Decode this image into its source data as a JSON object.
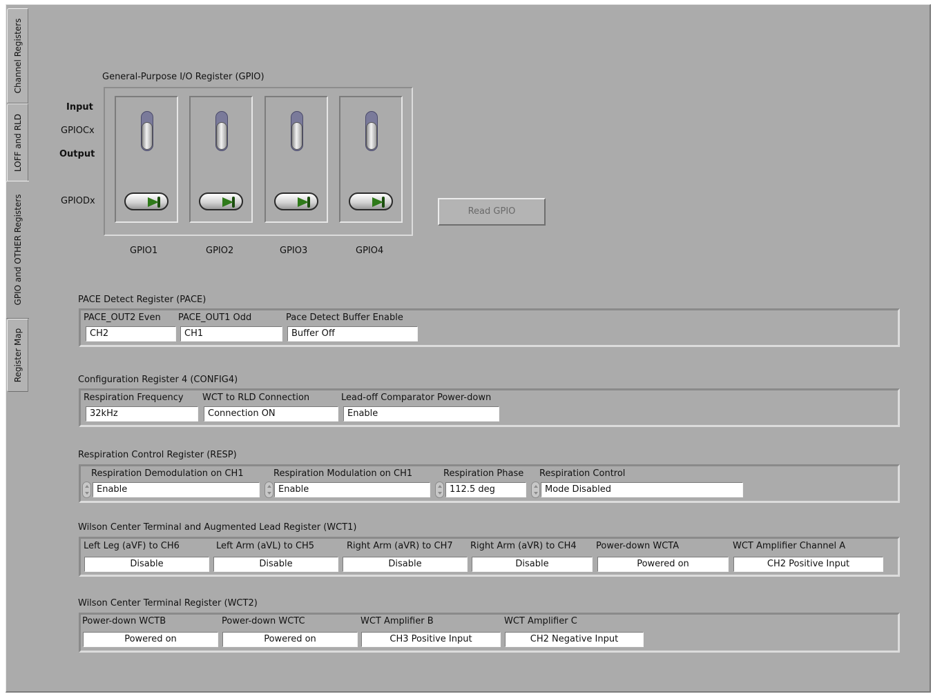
{
  "tabs": [
    {
      "label": "Channel Registers",
      "active": false
    },
    {
      "label": "LOFF and RLD",
      "active": false
    },
    {
      "label": "GPIO and OTHER Registers",
      "active": true
    },
    {
      "label": "Register Map",
      "active": false
    }
  ],
  "gpio": {
    "title": "General-Purpose I/O Register (GPIO)",
    "row_input": "Input",
    "row_gpiocx": "GPIOCx",
    "row_output": "Output",
    "row_gpiodx": "GPIODx",
    "columns": [
      "GPIO1",
      "GPIO2",
      "GPIO3",
      "GPIO4"
    ],
    "read_button": "Read GPIO"
  },
  "pace": {
    "title": "PACE Detect Register (PACE)",
    "fields": [
      {
        "label": "PACE_OUT2 Even",
        "value": "CH2"
      },
      {
        "label": "PACE_OUT1 Odd",
        "value": "CH1"
      },
      {
        "label": "Pace Detect Buffer Enable",
        "value": "Buffer Off"
      }
    ]
  },
  "config4": {
    "title": "Configuration Register 4 (CONFIG4)",
    "fields": [
      {
        "label": "Respiration Frequency",
        "value": "32kHz"
      },
      {
        "label": "WCT to RLD Connection",
        "value": "Connection ON"
      },
      {
        "label": "Lead-off Comparator Power-down",
        "value": "Enable"
      }
    ]
  },
  "resp": {
    "title": "Respiration Control Register (RESP)",
    "fields": [
      {
        "label": "Respiration Demodulation on CH1",
        "value": "Enable"
      },
      {
        "label": "Respiration Modulation on CH1",
        "value": "Enable"
      },
      {
        "label": "Respiration Phase",
        "value": "112.5 deg"
      },
      {
        "label": "Respiration Control",
        "value": "Mode Disabled"
      }
    ]
  },
  "wct1": {
    "title": "Wilson Center Terminal and Augmented Lead Register (WCT1)",
    "fields": [
      {
        "label": "Left Leg (aVF) to CH6",
        "value": "Disable"
      },
      {
        "label": "Left Arm (aVL) to CH5",
        "value": "Disable"
      },
      {
        "label": "Right Arm (aVR) to CH7",
        "value": "Disable"
      },
      {
        "label": "Right Arm (aVR) to CH4",
        "value": "Disable"
      },
      {
        "label": "Power-down WCTA",
        "value": "Powered on"
      },
      {
        "label": "WCT Amplifier Channel A",
        "value": "CH2 Positive Input"
      }
    ]
  },
  "wct2": {
    "title": "Wilson Center Terminal Register (WCT2)",
    "fields": [
      {
        "label": "Power-down WCTB",
        "value": "Powered on"
      },
      {
        "label": "Power-down WCTC",
        "value": "Powered on"
      },
      {
        "label": "WCT Amplifier B",
        "value": "CH3 Positive Input"
      },
      {
        "label": "WCT Amplifier C",
        "value": "CH2 Negative Input"
      }
    ]
  }
}
